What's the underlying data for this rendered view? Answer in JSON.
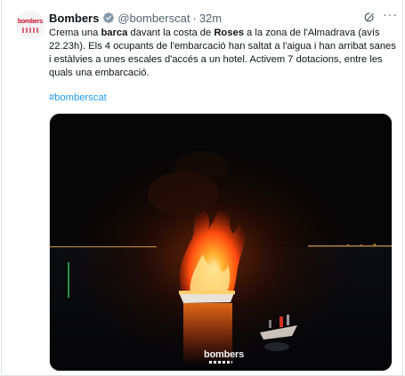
{
  "tweet": {
    "display_name": "Bombers",
    "handle": "@bomberscat",
    "separator": "·",
    "time": "32m",
    "more": "···",
    "text_parts": [
      "Crema una ",
      "barca",
      " davant la costa de ",
      "Roses",
      " a la zona de l'Almadrava (avís 22.23h). Els 4 ocupants de l'embarcació han saltat a l'aigua i han arribat sanes i estàlvies a unes escales d'accés a un hotel. Activem 7 dotacions, entre les quals una embarcació."
    ],
    "hashtag": "#bomberscat",
    "avatar_text": "bombers",
    "watermark": "bombers"
  },
  "icons": {
    "avatar": "bombers-logo-icon",
    "verified": "verified-badge-icon",
    "grok": "grok-icon",
    "more": "more-options-icon"
  },
  "colors": {
    "link": "#1d9bf0",
    "secondary": "#536471",
    "verified": "#829aab",
    "brand": "#c8102e"
  }
}
